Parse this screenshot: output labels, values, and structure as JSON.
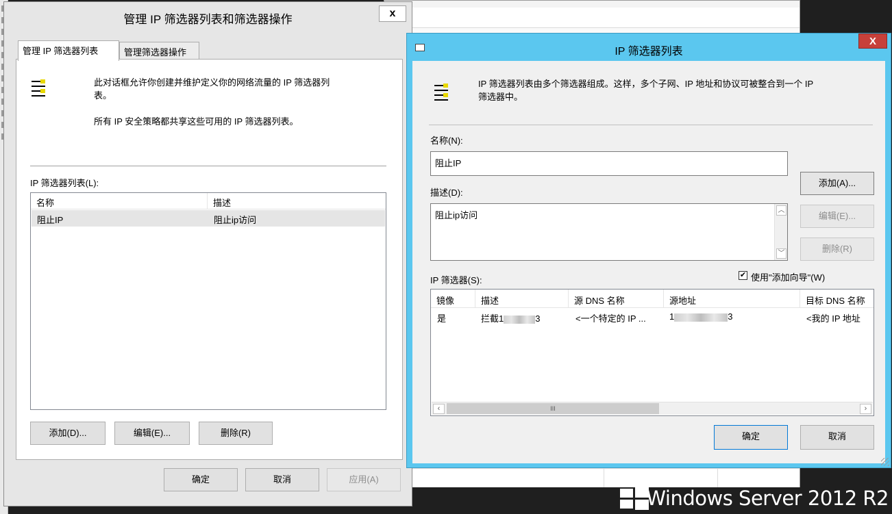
{
  "dialog1": {
    "title": "管理 IP 筛选器列表和筛选器操作",
    "close_glyph": "x",
    "tabs": [
      "管理 IP 筛选器列表",
      "管理筛选器操作"
    ],
    "description_line1": "此对话框允许你创建并维护定义你的网络流量的 IP 筛选器列",
    "description_line2": "表。",
    "description_line3": "所有 IP 安全策略都共享这些可用的 IP 筛选器列表。",
    "list_label": "IP 筛选器列表(L):",
    "columns": [
      "名称",
      "描述"
    ],
    "rows": [
      {
        "name": "阻止IP",
        "description": "阻止ip访问"
      }
    ],
    "add_button": "添加(D)...",
    "edit_button": "编辑(E)...",
    "delete_button": "删除(R)",
    "ok_button": "确定",
    "cancel_button": "取消",
    "apply_button": "应用(A)"
  },
  "dialog2": {
    "title": "IP 筛选器列表",
    "close_glyph": "X",
    "description_line1": "IP 筛选器列表由多个筛选器组成。这样，多个子网、IP 地址和协议可被整合到一个 IP",
    "description_line2": "筛选器中。",
    "name_label": "名称(N):",
    "name_value": "阻止IP",
    "desc_label": "描述(D):",
    "desc_value": "阻止ip访问",
    "add_button": "添加(A)...",
    "edit_button": "编辑(E)...",
    "delete_button": "删除(R)",
    "filters_label": "IP 筛选器(S):",
    "wizard_checkbox_label": "使用\"添加向导\"(W)",
    "wizard_checked": true,
    "filter_columns": [
      "镜像",
      "描述",
      "源 DNS 名称",
      "源地址",
      "目标 DNS 名称"
    ],
    "filter_rows": [
      {
        "mirror": "是",
        "description_prefix": "拦截1",
        "description_suffix": "3",
        "source_dns": "<一个特定的 IP ...",
        "source_address_prefix": "1",
        "source_address_suffix": "3",
        "dest_dns": "<我的 IP 地址"
      }
    ],
    "scroll_thumb_glyph": "III",
    "ok_button": "确定",
    "cancel_button": "取消"
  },
  "brand": {
    "text": "Windows Server 2012 R2"
  },
  "colors": {
    "dialog2_frame": "#5bc7ef",
    "close_red": "#c7403a",
    "focus_blue": "#0078d7"
  }
}
